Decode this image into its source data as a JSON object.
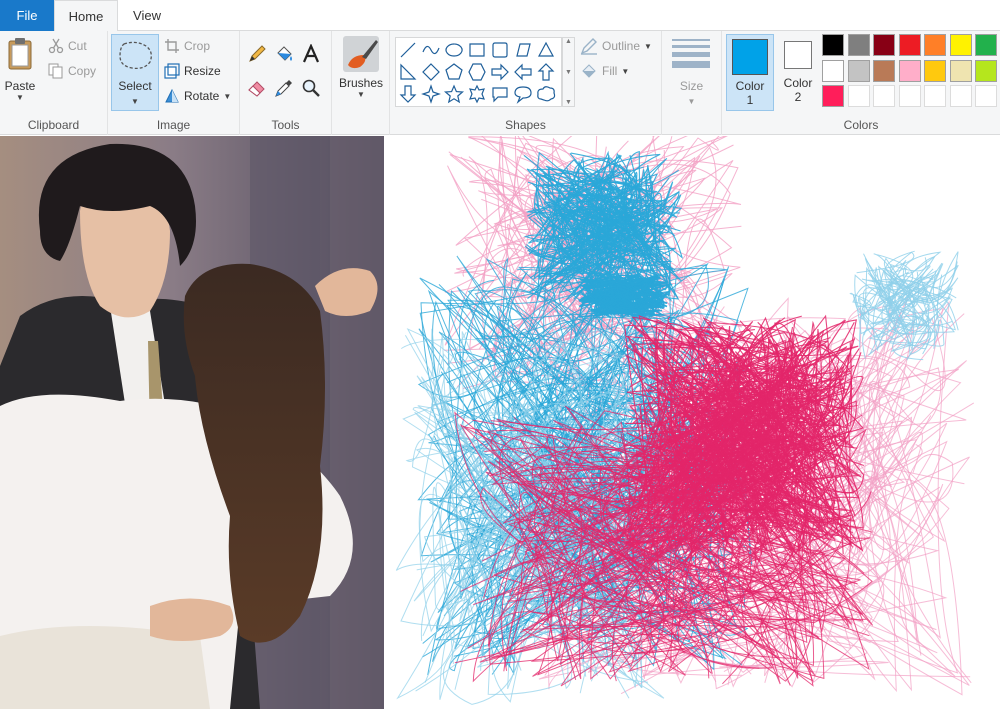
{
  "tabs": {
    "file": "File",
    "home": "Home",
    "view": "View"
  },
  "clipboard": {
    "paste": "Paste",
    "cut": "Cut",
    "copy": "Copy",
    "label": "Clipboard"
  },
  "image": {
    "select": "Select",
    "crop": "Crop",
    "resize": "Resize",
    "rotate": "Rotate",
    "label": "Image"
  },
  "tools": {
    "label": "Tools"
  },
  "brushes": {
    "label": "Brushes"
  },
  "shapes": {
    "outline": "Outline",
    "fill": "Fill",
    "label": "Shapes"
  },
  "size": {
    "label": "Size"
  },
  "colors": {
    "color1_label": "Color",
    "color1_num": "1",
    "color2_label": "Color",
    "color2_num": "2",
    "label": "Colors",
    "color1": "#00a2e8",
    "color2": "#ffffff",
    "palette_row1": [
      "#000000",
      "#7f7f7f",
      "#880015",
      "#ed1c24",
      "#ff7f27",
      "#fff200",
      "#22b14c"
    ],
    "palette_row2": [
      "#ffffff",
      "#c3c3c3",
      "#b97a57",
      "#ffaec9",
      "#ffc90e",
      "#efe4b0",
      "#b5e61d"
    ],
    "palette_row3": [
      "#ff1e5a"
    ]
  },
  "sketch": {
    "blue": "#2aa7d8",
    "pink": "#e3266a",
    "lightpink": "#f2a0c4",
    "lightblue": "#8fd0ea"
  }
}
